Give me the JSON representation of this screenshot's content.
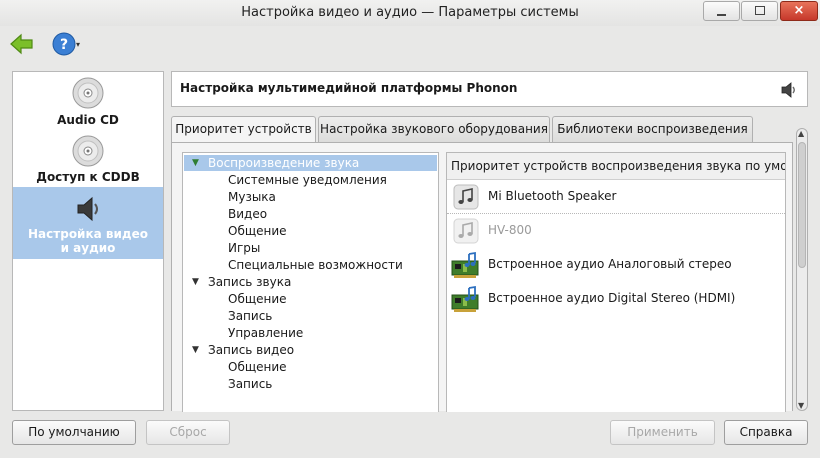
{
  "window": {
    "title": "Настройка видео и аудио — Параметры системы",
    "min_icon": "minimize-icon",
    "max_icon": "maximize-icon",
    "close_glyph": "×"
  },
  "toolbar": {
    "back_icon": "back-arrow-icon",
    "help_icon": "help-icon",
    "help_glyph": "?",
    "dropdown_glyph": "▾"
  },
  "sidebar": {
    "items": [
      {
        "label": "Audio CD",
        "icon": "cd-icon",
        "selected": false
      },
      {
        "label": "Доступ к CDDB",
        "icon": "cd-icon",
        "selected": false
      },
      {
        "label": "Настройка видео\nи аудио",
        "line1": "Настройка видео",
        "line2": "и аудио",
        "icon": "speaker-icon",
        "selected": true
      }
    ]
  },
  "header": {
    "title": "Настройка мультимедийной платформы Phonon",
    "icon": "speaker-icon"
  },
  "tabs": [
    {
      "label": "Приоритет устройств",
      "active": true
    },
    {
      "label": "Настройка звукового оборудования",
      "active": false
    },
    {
      "label": "Библиотеки воспроизведения",
      "active": false
    }
  ],
  "tree": {
    "groups": [
      {
        "label": "Воспроизведение звука",
        "expanded": true,
        "selected": true,
        "children": [
          "Системные уведомления",
          "Музыка",
          "Видео",
          "Общение",
          "Игры",
          "Специальные возможности"
        ]
      },
      {
        "label": "Запись звука",
        "expanded": true,
        "selected": false,
        "children": [
          "Общение",
          "Запись",
          "Управление"
        ]
      },
      {
        "label": "Запись видео",
        "expanded": true,
        "selected": false,
        "children": [
          "Общение",
          "Запись"
        ]
      }
    ],
    "expand_glyph": "▼"
  },
  "devices": {
    "header": "Приоритет устройств воспроизведения звука по умолч",
    "items": [
      {
        "label": "Mi Bluetooth Speaker",
        "icon": "music-note-icon",
        "disabled": false
      },
      {
        "label": "HV-800",
        "icon": "music-note-icon",
        "disabled": true
      },
      {
        "label": "Встроенное аудио Аналоговый стерео",
        "icon": "sound-card-icon",
        "disabled": false
      },
      {
        "label": "Встроенное аудио Digital Stereo (HDMI)",
        "icon": "sound-card-icon",
        "disabled": false
      }
    ]
  },
  "buttons": {
    "defaults": "По умолчанию",
    "reset": "Сброс",
    "apply": "Применить",
    "help": "Справка"
  },
  "colors": {
    "selection": "#a9c8ea",
    "close_button": "#c6382b",
    "back_arrow": "#6aa51e",
    "help_icon": "#2f6fc2"
  }
}
